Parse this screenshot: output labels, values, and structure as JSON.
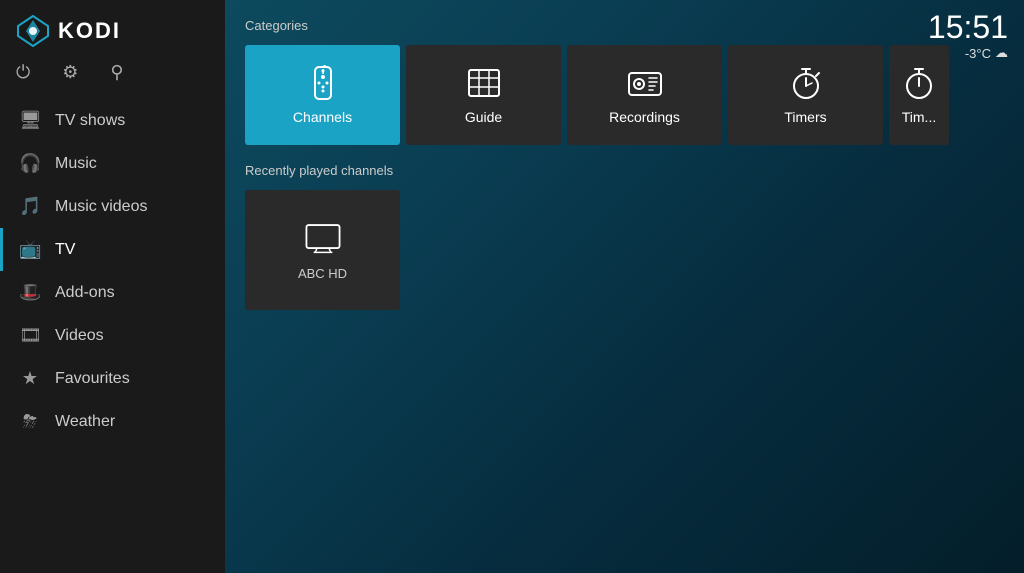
{
  "app": {
    "title": "KODI"
  },
  "clock": {
    "time": "15:51",
    "temperature": "-3°C",
    "weather_icon": "☁"
  },
  "sidebar": {
    "top_icons": [
      {
        "name": "power-icon",
        "symbol": "⏻"
      },
      {
        "name": "settings-icon",
        "symbol": "⚙"
      },
      {
        "name": "search-icon",
        "symbol": "🔍"
      }
    ],
    "nav_items": [
      {
        "id": "tv-shows",
        "label": "TV shows",
        "icon": "🖥"
      },
      {
        "id": "music",
        "label": "Music",
        "icon": "🎧"
      },
      {
        "id": "music-videos",
        "label": "Music videos",
        "icon": "🎵"
      },
      {
        "id": "tv",
        "label": "TV",
        "icon": "📺",
        "active": true
      },
      {
        "id": "add-ons",
        "label": "Add-ons",
        "icon": "🎩"
      },
      {
        "id": "videos",
        "label": "Videos",
        "icon": "🎞"
      },
      {
        "id": "favourites",
        "label": "Favourites",
        "icon": "⭐"
      },
      {
        "id": "weather",
        "label": "Weather",
        "icon": "🌩"
      }
    ]
  },
  "main": {
    "categories_title": "Categories",
    "categories": [
      {
        "id": "channels",
        "label": "Channels",
        "active": true
      },
      {
        "id": "guide",
        "label": "Guide",
        "active": false
      },
      {
        "id": "recordings",
        "label": "Recordings",
        "active": false
      },
      {
        "id": "timers",
        "label": "Timers",
        "active": false
      },
      {
        "id": "timers2",
        "label": "Tim...",
        "active": false
      }
    ],
    "recently_played_title": "Recently played channels",
    "channels": [
      {
        "id": "abc-hd",
        "label": "ABC HD"
      }
    ]
  }
}
